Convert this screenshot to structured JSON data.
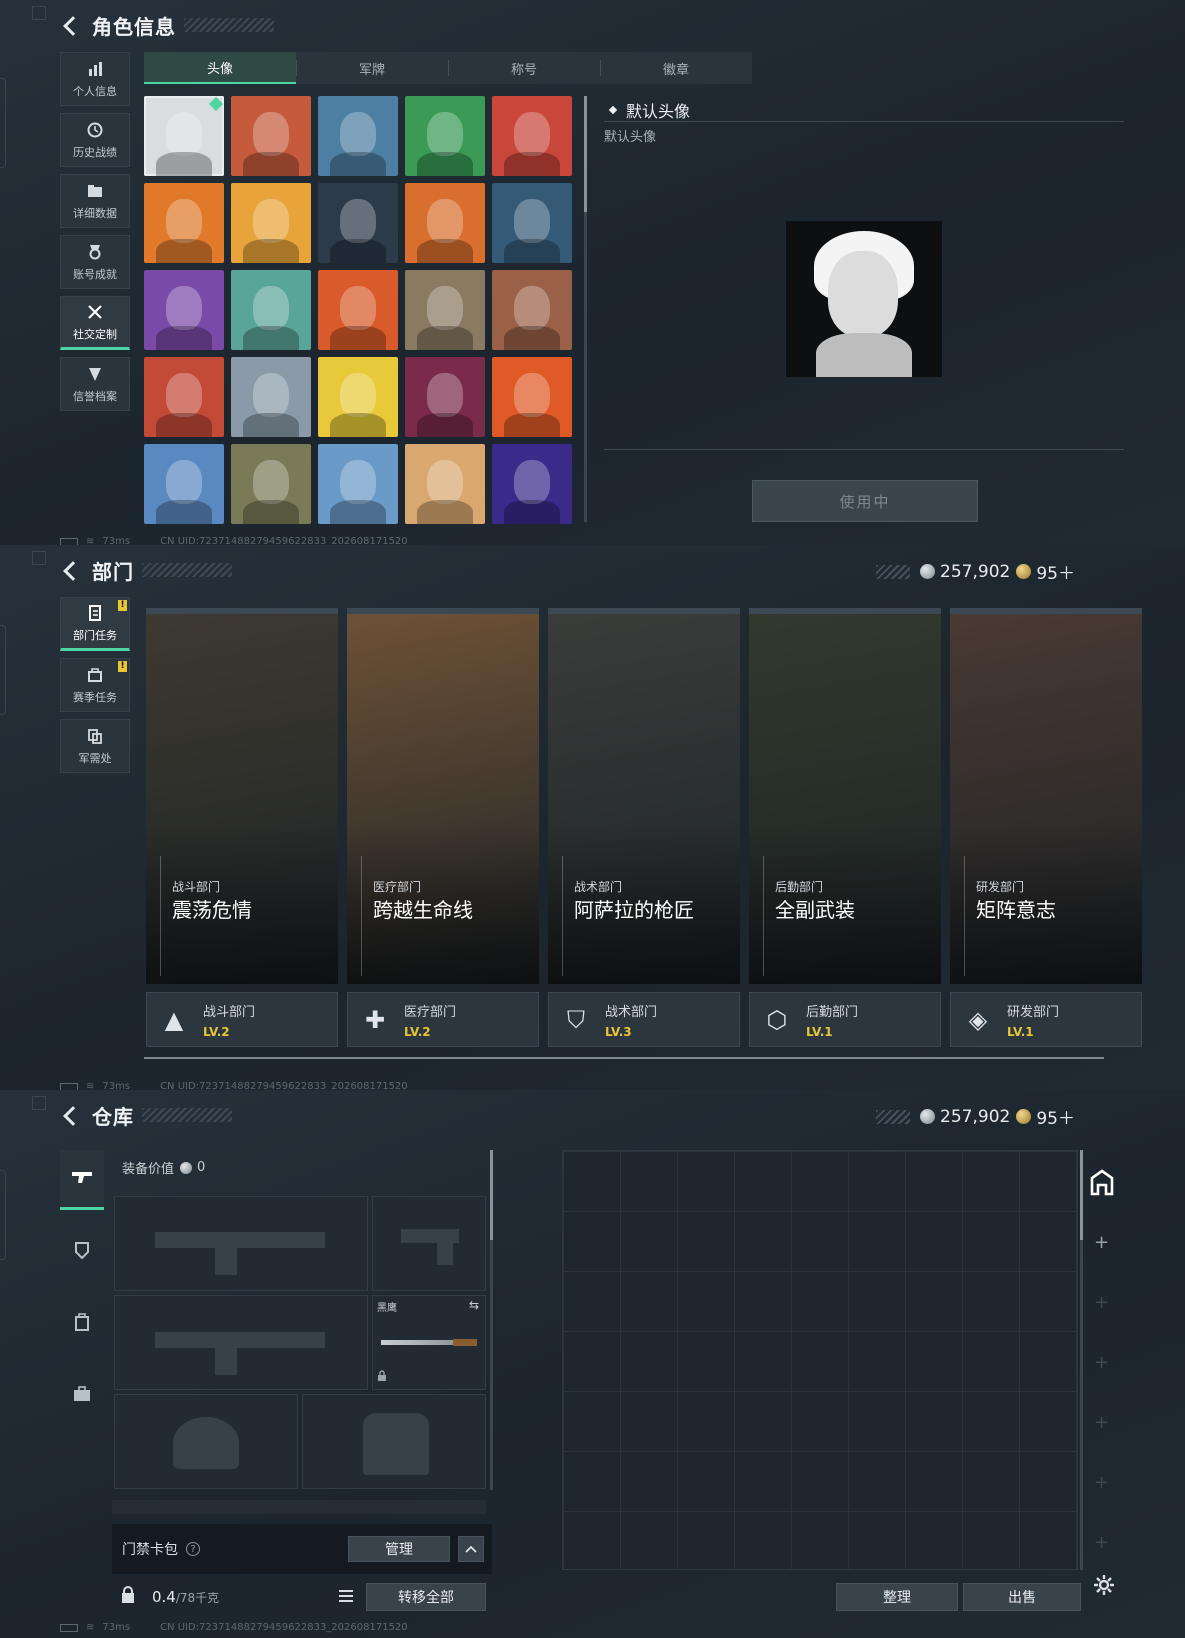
{
  "char_panel": {
    "title": "角色信息",
    "nav": [
      {
        "label": "个人信息",
        "icon": "bar-chart-icon"
      },
      {
        "label": "历史战绩",
        "icon": "clock-icon"
      },
      {
        "label": "详细数据",
        "icon": "folder-icon"
      },
      {
        "label": "账号成就",
        "icon": "medal-icon"
      },
      {
        "label": "社交定制",
        "icon": "tools-icon",
        "active": true
      },
      {
        "label": "信誉档案",
        "icon": "shield-icon"
      }
    ],
    "tabs": [
      "头像",
      "军牌",
      "称号",
      "徽章"
    ],
    "avatar_colors": [
      "#d9dde0",
      "#c55a3c",
      "#4d7fa3",
      "#3a9a56",
      "#c9463b",
      "#e07a2a",
      "#e8a43a",
      "#2c3a4a",
      "#d96f2e",
      "#355a78",
      "#7a4aa8",
      "#5aa59a",
      "#d95a2a",
      "#8a7a62",
      "#9a6048",
      "#c44a38",
      "#8a9aa8",
      "#e8c93a",
      "#7a2a4a",
      "#e05a28",
      "#5a88c0",
      "#7a7a58",
      "#6a9ac8",
      "#d8a870",
      "#3a2a8a"
    ],
    "preview_title": "默认头像",
    "preview_subtitle": "默认头像",
    "use_button": "使用中",
    "status": {
      "latency": "73ms",
      "uid": "CN UID:72371488279459622833_202608171520"
    }
  },
  "dept_panel": {
    "title": "部门",
    "currency_silver": "257,902",
    "currency_gold": "95＋",
    "nav": [
      {
        "label": "部门任务",
        "icon": "task-icon",
        "active": true,
        "badge": "!"
      },
      {
        "label": "赛季任务",
        "icon": "season-icon",
        "badge": "!"
      },
      {
        "label": "军需处",
        "icon": "supply-icon"
      }
    ],
    "departments": [
      {
        "category": "战斗部门",
        "name": "震荡危情",
        "level": "LV.2",
        "color": "#3e3a30"
      },
      {
        "category": "医疗部门",
        "name": "跨越生命线",
        "level": "LV.2",
        "color": "#6e5236"
      },
      {
        "category": "战术部门",
        "name": "阿萨拉的枪匠",
        "level": "LV.3",
        "color": "#3a3d3a"
      },
      {
        "category": "后勤部门",
        "name": "全副武装",
        "level": "LV.1",
        "color": "#323a2c"
      },
      {
        "category": "研发部门",
        "name": "矩阵意志",
        "level": "LV.1",
        "color": "#4a3a32"
      }
    ],
    "status": {
      "latency": "73ms",
      "uid": "CN UID:72371488279459622833_202608171520"
    }
  },
  "warehouse_panel": {
    "title": "仓库",
    "currency_silver": "257,902",
    "currency_gold": "95＋",
    "equip_value_label": "装备价值",
    "equip_value": "0",
    "melee_label": "黑鹰",
    "cardpack_label": "门禁卡包",
    "manage_button": "管理",
    "weight": "0.4",
    "weight_max": "/78千克",
    "transfer_all": "转移全部",
    "sort_button": "整理",
    "sell_button": "出售",
    "status": {
      "latency": "73ms",
      "uid": "CN UID:72371488279459622833_202608171520"
    }
  }
}
